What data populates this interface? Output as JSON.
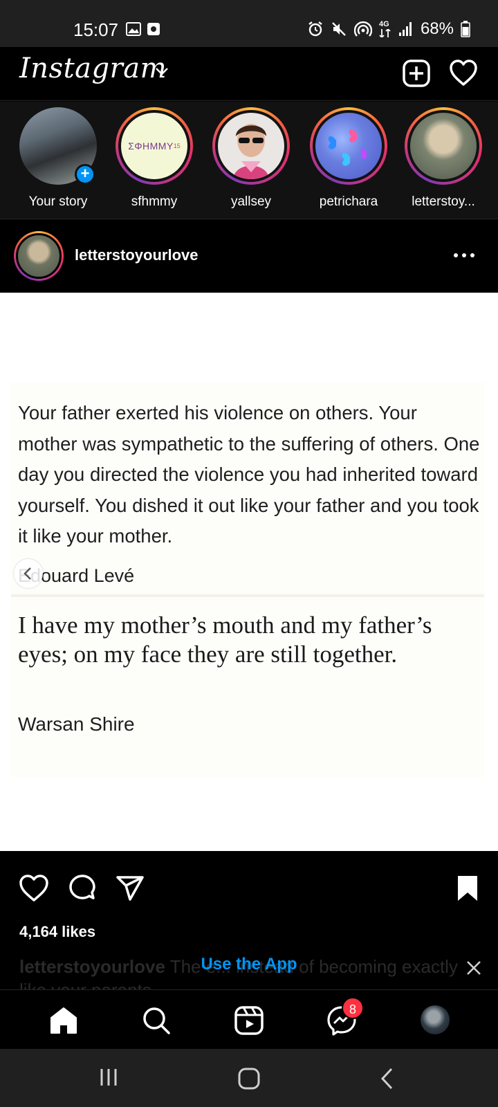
{
  "status_bar": {
    "time": "15:07",
    "battery": "68%",
    "network": "4G"
  },
  "header": {
    "logo": "Instagram"
  },
  "stories": [
    {
      "name": "Your story",
      "own": true
    },
    {
      "name": "sfhmmy",
      "avatar_text": "ΣΦΗΜΜΥ",
      "avatar_sup": "15"
    },
    {
      "name": "yallsey"
    },
    {
      "name": "petrichara"
    },
    {
      "name": "letterstoy..."
    }
  ],
  "post": {
    "username": "letterstoyourlove",
    "quote1": "Your father exerted his violence on others. Your mother was sympathetic to the suffering of others. One day you directed the violence you had inherited toward yourself. You dished it out like your father and you took it like your mother.",
    "quote1_author": "Edouard Levé",
    "quote2": "I have my mother’s mouth and my father’s eyes; on my face they are still together.",
    "quote2_author": "Warsan Shire",
    "likes": "4,164 likes",
    "caption_user": "letterstoyourlove",
    "caption_text": "The e... instead of becoming exactly like your parents"
  },
  "app_banner": {
    "label": "Use the App"
  },
  "bottom_nav": {
    "messages_badge": "8"
  },
  "colors": {
    "accent": "#0095f6",
    "badge": "#ff3040",
    "background": "#000000"
  }
}
